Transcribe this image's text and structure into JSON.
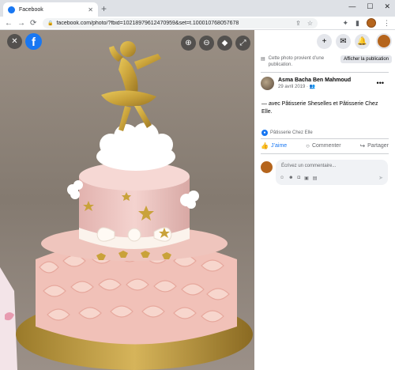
{
  "browser": {
    "tab_title": "Facebook",
    "tab_close": "✕",
    "new_tab": "+",
    "window_controls": [
      "—",
      "☐",
      "✕"
    ],
    "url": "facebook.com/photo/?fbid=10218979612470959&set=t.100010768057678",
    "nav": {
      "back": "←",
      "forward": "→",
      "reload": "⟳"
    },
    "omnibox_icons": [
      "share-icon",
      "star-icon"
    ],
    "extension_icons": [
      "puzzle-icon",
      "sidebar-icon",
      "profile-avatar",
      "menu-icon"
    ]
  },
  "viewer": {
    "close_glyph": "✕",
    "logo_glyph": "f",
    "zoom_in_glyph": "⊕",
    "zoom_out_glyph": "⊖",
    "tag_glyph": "◆",
    "fullscreen_glyph": "⤢"
  },
  "panel_top": {
    "plus_glyph": "+",
    "messenger_glyph": "✉",
    "bell_glyph": "🔔"
  },
  "notice": {
    "text": "Cette photo provient d’une publication.",
    "button": "Afficher la publication"
  },
  "post": {
    "author": "Asma Bacha Ben Mahmoud",
    "date": "29 avril 2019 · ",
    "audience_glyph": "👥",
    "more_glyph": "•••",
    "caption": "— avec Pâtisserie Sheselles et Pâtisserie Chez Elle.",
    "tag": "Pâtisserie Chez Elle"
  },
  "actions": {
    "like": "J’aime",
    "comment": "Commenter",
    "share": "Partager"
  },
  "comment_box": {
    "placeholder": "Écrivez un commentaire...",
    "tools": [
      "☺",
      "☻",
      "◘",
      "▣",
      "▤"
    ],
    "send_glyph": "➤"
  },
  "colors": {
    "facebook_blue": "#1877f2",
    "panel_bg": "#ffffff",
    "secondary_text": "#65676b"
  }
}
